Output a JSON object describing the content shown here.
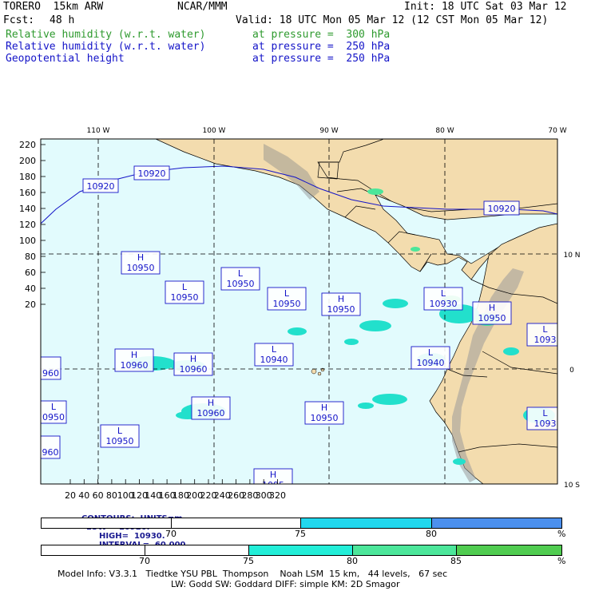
{
  "header": {
    "model": "TORERO  15km ARW",
    "center": "NCAR/MMM",
    "init": "Init: 18 UTC Sat 03 Mar 12",
    "fcst_label": "Fcst:",
    "fcst_value": "48 h",
    "valid": "Valid: 18 UTC Mon 05 Mar 12 (12 CST Mon 05 Mar 12)",
    "fields": [
      {
        "name": "Relative humidity (w.r.t. water)",
        "level": "at pressure =  300 hPa",
        "color": "#2e9a2e"
      },
      {
        "name": "Relative humidity (w.r.t. water)",
        "level": "at pressure =  250 hPa",
        "color": "#1414c8"
      },
      {
        "name": "Geopotential height",
        "level": "at pressure =  250 hPa",
        "color": "#1414c8"
      }
    ]
  },
  "map": {
    "lon_labels": [
      "110 W",
      "100 W",
      "90 W",
      "80 W",
      "70 W"
    ],
    "lat_labels": [
      "10 N",
      "0",
      "10 S"
    ],
    "y_ticks": [
      "220",
      "200",
      "180",
      "160",
      "140",
      "120",
      "100",
      "80",
      "60",
      "40",
      "20"
    ],
    "x_ticks": [
      "20",
      "40",
      "60",
      "80",
      "100",
      "120",
      "140",
      "160",
      "180",
      "200",
      "220",
      "240",
      "260",
      "280",
      "300",
      "320"
    ],
    "height_labels": [
      {
        "text": "10920"
      },
      {
        "text": "10920"
      },
      {
        "text": "10920"
      },
      {
        "sym": "H",
        "text": "10950"
      },
      {
        "sym": "L",
        "text": "10950"
      },
      {
        "sym": "L",
        "text": "10950"
      },
      {
        "sym": "L",
        "text": "10950"
      },
      {
        "sym": "H",
        "text": "10950"
      },
      {
        "sym": "L",
        "text": "10930"
      },
      {
        "sym": "H",
        "text": "10950"
      },
      {
        "sym": "L",
        "text": "1093"
      },
      {
        "sym": "H",
        "text": "10960"
      },
      {
        "sym": "H",
        "text": "10960"
      },
      {
        "sym": "L",
        "text": "10940"
      },
      {
        "sym": "L",
        "text": "10940"
      },
      {
        "sym": "",
        "text": "960"
      },
      {
        "sym": "H",
        "text": "10960"
      },
      {
        "sym": "H",
        "text": "10950"
      },
      {
        "sym": "L",
        "text": "0950"
      },
      {
        "sym": "L",
        "text": "1093"
      },
      {
        "sym": "L",
        "text": "10950"
      },
      {
        "sym": "",
        "text": "960"
      },
      {
        "sym": "H",
        "text": "1095"
      }
    ]
  },
  "contour_info": {
    "units": "CONTOURS:  UNITS=m",
    "low": "LOW=  10920.",
    "high": "HIGH=  10930.",
    "interval": "INTERVAL=  60.000"
  },
  "colorbar_250": {
    "ticks": [
      "70",
      "75",
      "80",
      "%"
    ],
    "colors": [
      "#ffffff",
      "#22d8ee",
      "#4c90ee"
    ]
  },
  "colorbar_300": {
    "ticks": [
      "70",
      "75",
      "80",
      "85",
      "%"
    ],
    "colors": [
      "#ffffff",
      "#22eed8",
      "#4ce69a",
      "#50cc50"
    ]
  },
  "footer": {
    "line1": "Model Info: V3.3.1   Tiedtke YSU PBL  Thompson    Noah LSM  15 km,   44 levels,   67 sec",
    "line2": "LW: Godd SW: Goddard DIFF: simple KM: 2D Smagor"
  }
}
